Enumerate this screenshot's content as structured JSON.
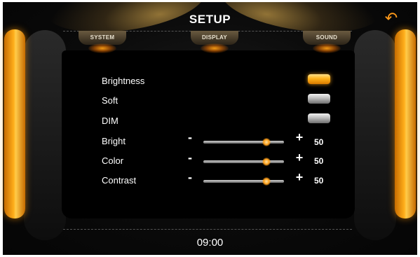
{
  "header": {
    "title": "SETUP",
    "back_icon": "back-arrow-icon"
  },
  "tabs": [
    {
      "label": "SYSTEM"
    },
    {
      "label": "DISPLAY",
      "active": true
    },
    {
      "label": "SOUND"
    }
  ],
  "display_modes": [
    {
      "label": "Brightness",
      "selected": true
    },
    {
      "label": "Soft",
      "selected": false
    },
    {
      "label": "DIM",
      "selected": false
    }
  ],
  "sliders": [
    {
      "label": "Bright",
      "value": "50",
      "level": 0.78
    },
    {
      "label": "Color",
      "value": "50",
      "level": 0.78
    },
    {
      "label": "Contrast",
      "value": "50",
      "level": 0.78
    }
  ],
  "controls": {
    "minus": "-",
    "plus": "+"
  },
  "status": {
    "clock": "09:00"
  },
  "colors": {
    "accent": "#ff9a1a",
    "background": "#0a0a0a"
  }
}
